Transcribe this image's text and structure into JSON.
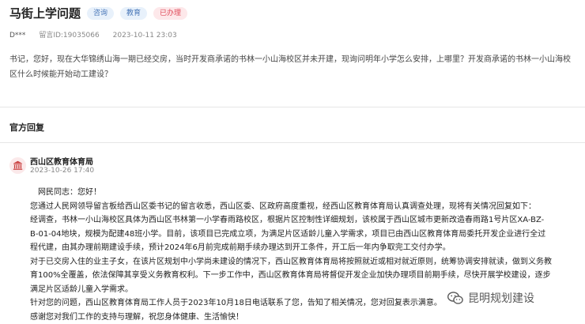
{
  "header": {
    "title": "马街上学问题",
    "tags": [
      "咨询",
      "教育",
      "已办理"
    ]
  },
  "meta": {
    "author": "D***",
    "message_id": "留言ID:19035066",
    "time": "2023-10-11 23:03"
  },
  "question": {
    "text": "书记，您好，现在大华锦绣山海一期已经交房，当时开发商承诺的书林一小山海校区并未开建，现询问明年小学怎么安排，上哪里？开发商承诺的书林一小山海校区什么时候能开始动工建设？"
  },
  "reply_section": {
    "title": "官方回复",
    "org": "西山区教育体育局",
    "time": "2023-10-26 17:40",
    "paragraphs": [
      "网民同志：您好！",
      "您通过人民网领导留言板给西山区委书记的留言收悉，西山区委、区政府高度重视，经西山区教育体育局认真调查处理，现将有关情况回复如下：",
      "经调查，书林一小山海校区具体为西山区书林第一小学春雨路校区，根据片区控制性详细规划，该校属于西山区城市更新改造春雨路1号片区XA-BZ-B-01-04地块，规模为配建48班小学。目前，该项目已完成立项，为满足片区适龄儿童入学需求，项目已由西山区教育体育局委托开发企业进行全过程代建，由其办理前期建设手续，预计2024年6月前完成前期手续办理达到开工条件，开工后一年内争取完工交付办学。",
      "对于已交房入住的业主子女，在该片区规划中小学尚未建设的情况下，西山区教育体育局将按照就近或相对就近原则，统筹协调安排就读，做到义务教育100%全覆盖，依法保障其享受义务教育权利。下一步工作中，西山区教育体育局将督促开发企业加快办理项目前期手续，尽快开展学校建设，逐步满足片区适龄儿童入学需求。",
      "针对您的问题，西山区教育体育局工作人员于2023年10月18日电话联系了您，告知了相关情况，您对回复表示满意。",
      "感谢您对我们工作的支持与理解，祝您身体健康、生活愉快！"
    ]
  },
  "watermark": {
    "text": "昆明规划建设"
  },
  "colors": {
    "tag_blue_bg": "#e8f1fb",
    "tag_blue_text": "#4a78b8",
    "tag_red_bg": "#fde8ea",
    "tag_red_text": "#e04a59",
    "avatar_icon": "#c83b3b"
  },
  "icons": {
    "avatar": "government-building-icon",
    "watermark": "wechat-logo-icon"
  }
}
